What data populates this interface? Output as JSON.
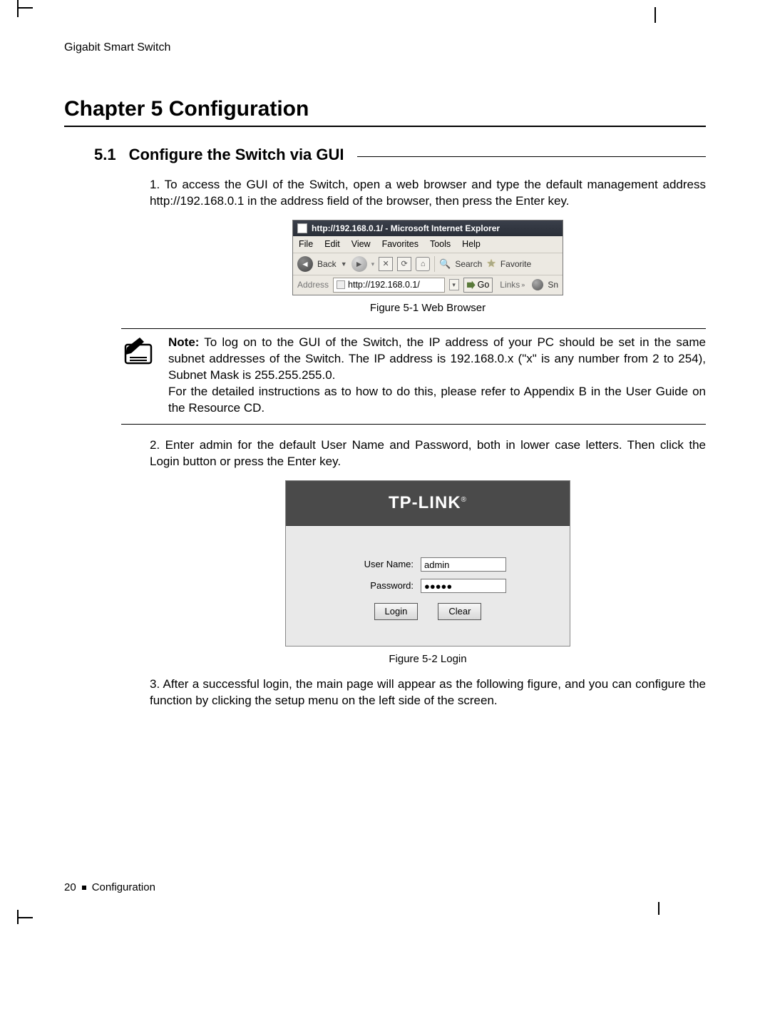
{
  "running_head": "Gigabit Smart Switch",
  "chapter_title": "Chapter 5 Configuration",
  "section": {
    "num": "5.1",
    "title": "Configure the Switch via GUI"
  },
  "steps": {
    "s1": {
      "num": "1.",
      "text": "To access the GUI of the Switch, open a web browser and type the default management address http://192.168.0.1 in the address field of the browser, then press the Enter key."
    },
    "s2": {
      "num": "2.",
      "text": "Enter admin for the default User Name and Password, both in lower case letters. Then click the Login button or press the Enter key."
    },
    "s3": {
      "num": "3.",
      "text": "After a successful login, the main page will appear as the following figure, and you can configure the function by clicking the setup menu on the left side of the screen."
    }
  },
  "figures": {
    "f1": "Figure 5-1  Web Browser",
    "f2": "Figure 5-2  Login"
  },
  "ie": {
    "titlebar": "http://192.168.0.1/ - Microsoft Internet Explorer",
    "menu": {
      "file": "File",
      "edit": "Edit",
      "view": "View",
      "favorites": "Favorites",
      "tools": "Tools",
      "help": "Help"
    },
    "toolbar": {
      "back": "Back",
      "search": "Search",
      "favorite": "Favorite"
    },
    "address_label": "Address",
    "url": "http://192.168.0.1/",
    "go": "Go",
    "links": "Links",
    "sn": "Sn"
  },
  "note": {
    "label": "Note:",
    "body1": "To log on to the GUI of the Switch, the IP address of your PC should be set in the same subnet addresses of the Switch. The IP address is 192.168.0.x (\"x\" is any number from 2 to 254), Subnet Mask is 255.255.255.0.",
    "body2": "For the detailed instructions as to how to do this, please refer to Appendix B in the User Guide on the Resource CD."
  },
  "login": {
    "brand": "TP-LINK",
    "username_label": "User Name:",
    "username_value": "admin",
    "password_label": "Password:",
    "password_value": "●●●●●",
    "login_btn": "Login",
    "clear_btn": "Clear"
  },
  "footer": {
    "page": "20",
    "section": "Configuration"
  }
}
